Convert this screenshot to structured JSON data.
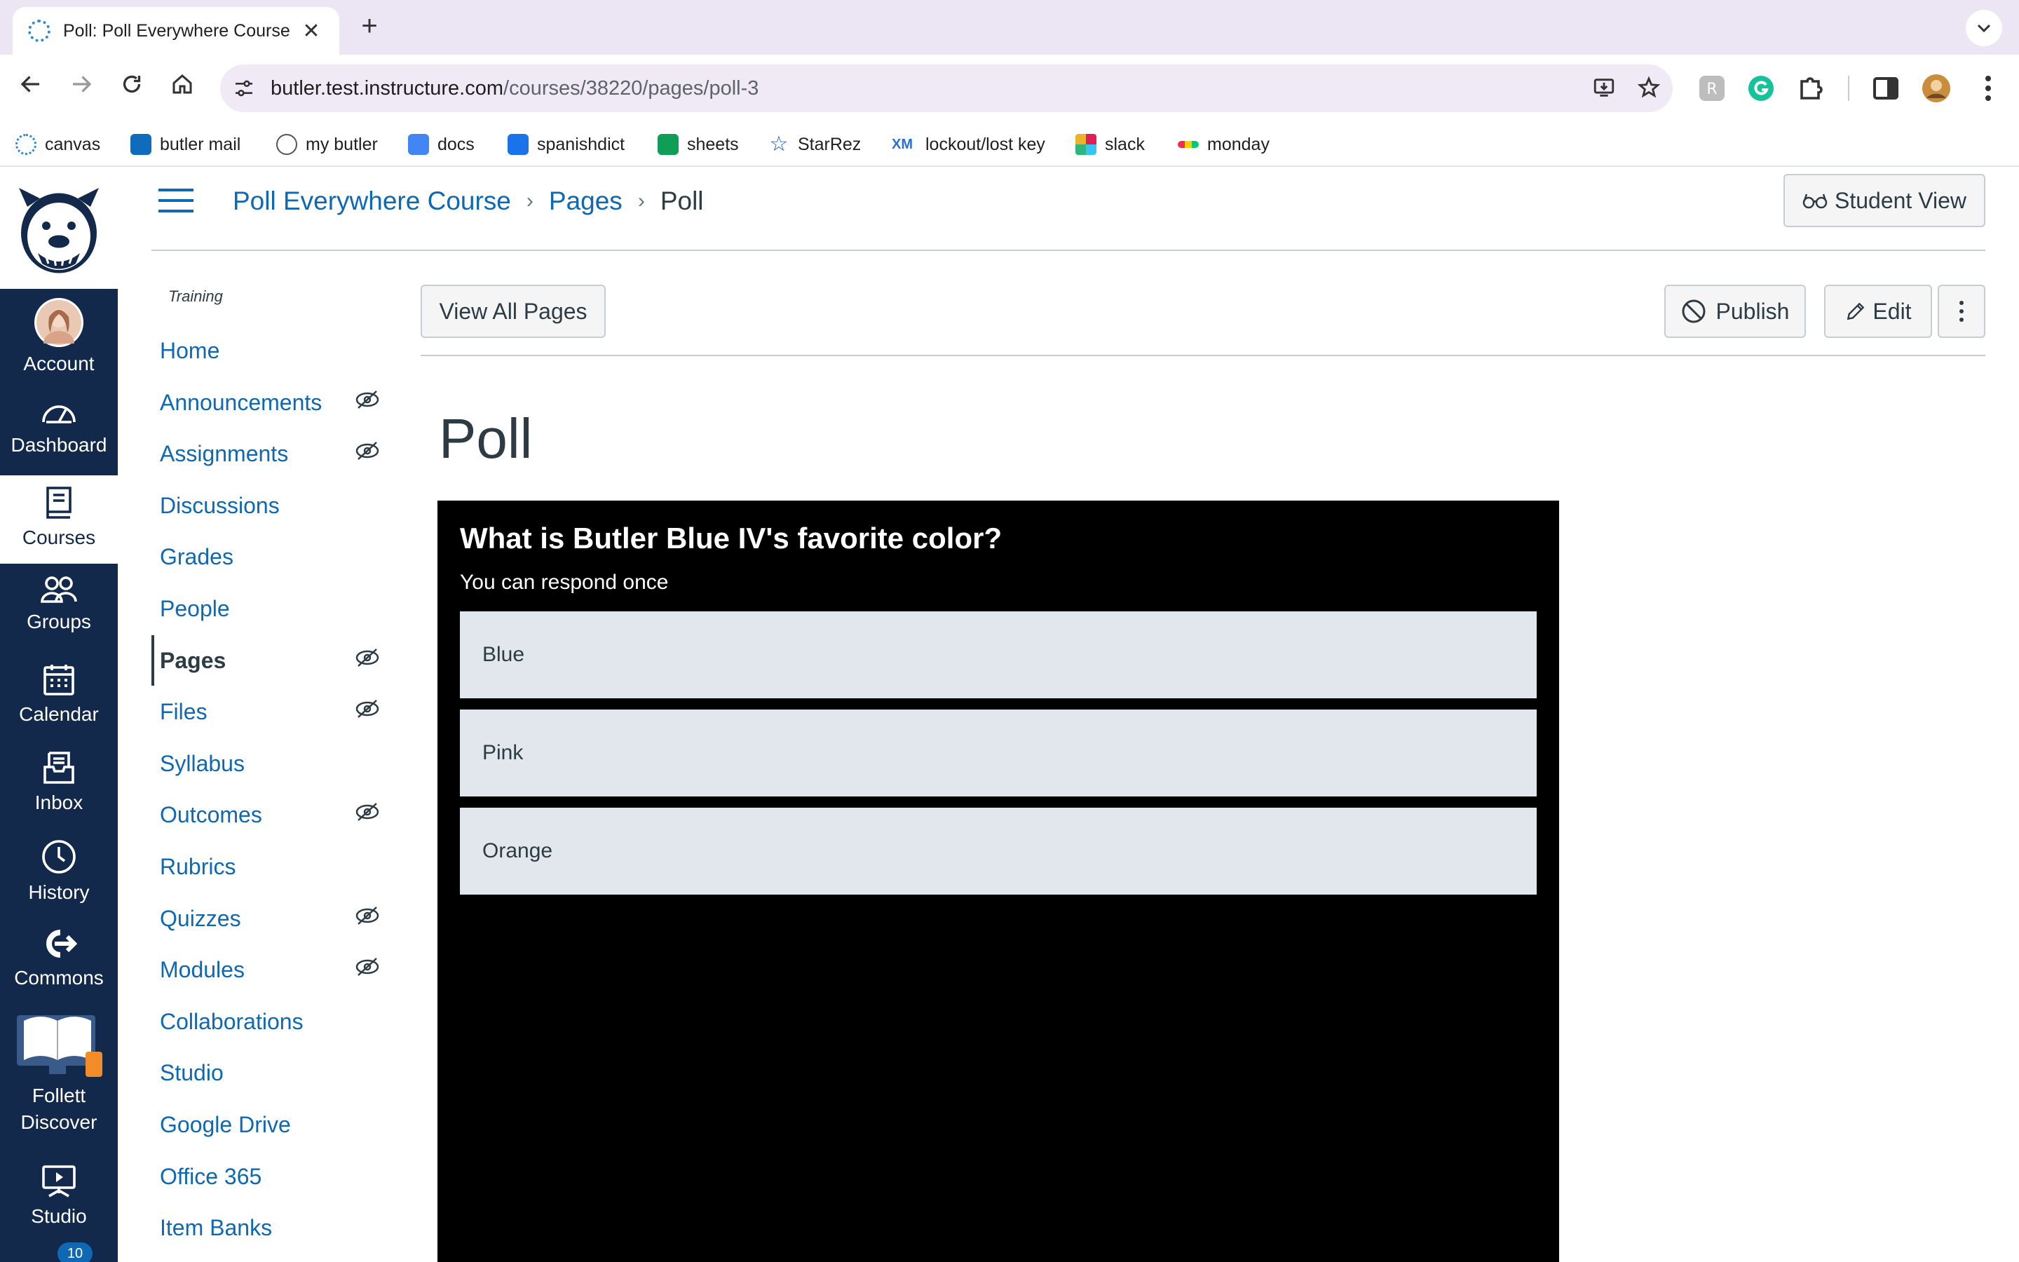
{
  "browser": {
    "tab_title": "Poll: Poll Everywhere Course",
    "url_host": "butler.test.instructure.com",
    "url_path": "/courses/38220/pages/poll-3"
  },
  "bookmarks": [
    {
      "label": "canvas"
    },
    {
      "label": "butler mail"
    },
    {
      "label": "my butler"
    },
    {
      "label": "docs"
    },
    {
      "label": "spanishdict"
    },
    {
      "label": "sheets"
    },
    {
      "label": "StarRez"
    },
    {
      "label": "lockout/lost key"
    },
    {
      "label": "slack"
    },
    {
      "label": "monday"
    }
  ],
  "global_nav": {
    "items": [
      {
        "label": "Account"
      },
      {
        "label": "Dashboard"
      },
      {
        "label": "Courses"
      },
      {
        "label": "Groups"
      },
      {
        "label": "Calendar"
      },
      {
        "label": "Inbox"
      },
      {
        "label": "History"
      },
      {
        "label": "Commons"
      },
      {
        "label": "Follett Discover"
      },
      {
        "label": "Studio"
      }
    ],
    "inbox_badge": "10"
  },
  "breadcrumb": {
    "course": "Poll Everywhere Course",
    "section": "Pages",
    "current": "Poll"
  },
  "header": {
    "student_view_label": "Student View"
  },
  "course_nav": {
    "term": "Training",
    "items": [
      {
        "label": "Home"
      },
      {
        "label": "Announcements"
      },
      {
        "label": "Assignments"
      },
      {
        "label": "Discussions"
      },
      {
        "label": "Grades"
      },
      {
        "label": "People"
      },
      {
        "label": "Pages"
      },
      {
        "label": "Files"
      },
      {
        "label": "Syllabus"
      },
      {
        "label": "Outcomes"
      },
      {
        "label": "Rubrics"
      },
      {
        "label": "Quizzes"
      },
      {
        "label": "Modules"
      },
      {
        "label": "Collaborations"
      },
      {
        "label": "Studio"
      },
      {
        "label": "Google Drive"
      },
      {
        "label": "Office 365"
      },
      {
        "label": "Item Banks"
      }
    ]
  },
  "content": {
    "view_all_label": "View All Pages",
    "publish_label": "Publish",
    "edit_label": "Edit",
    "page_title": "Poll"
  },
  "poll": {
    "question": "What is Butler Blue IV's favorite color?",
    "subtitle": "You can respond once",
    "options": [
      "Blue",
      "Pink",
      "Orange"
    ]
  },
  "colors": {
    "nav_bg": "#13294b",
    "link": "#0e68b3",
    "poll_bg": "#000000",
    "option_bg": "#e2e6ed"
  }
}
